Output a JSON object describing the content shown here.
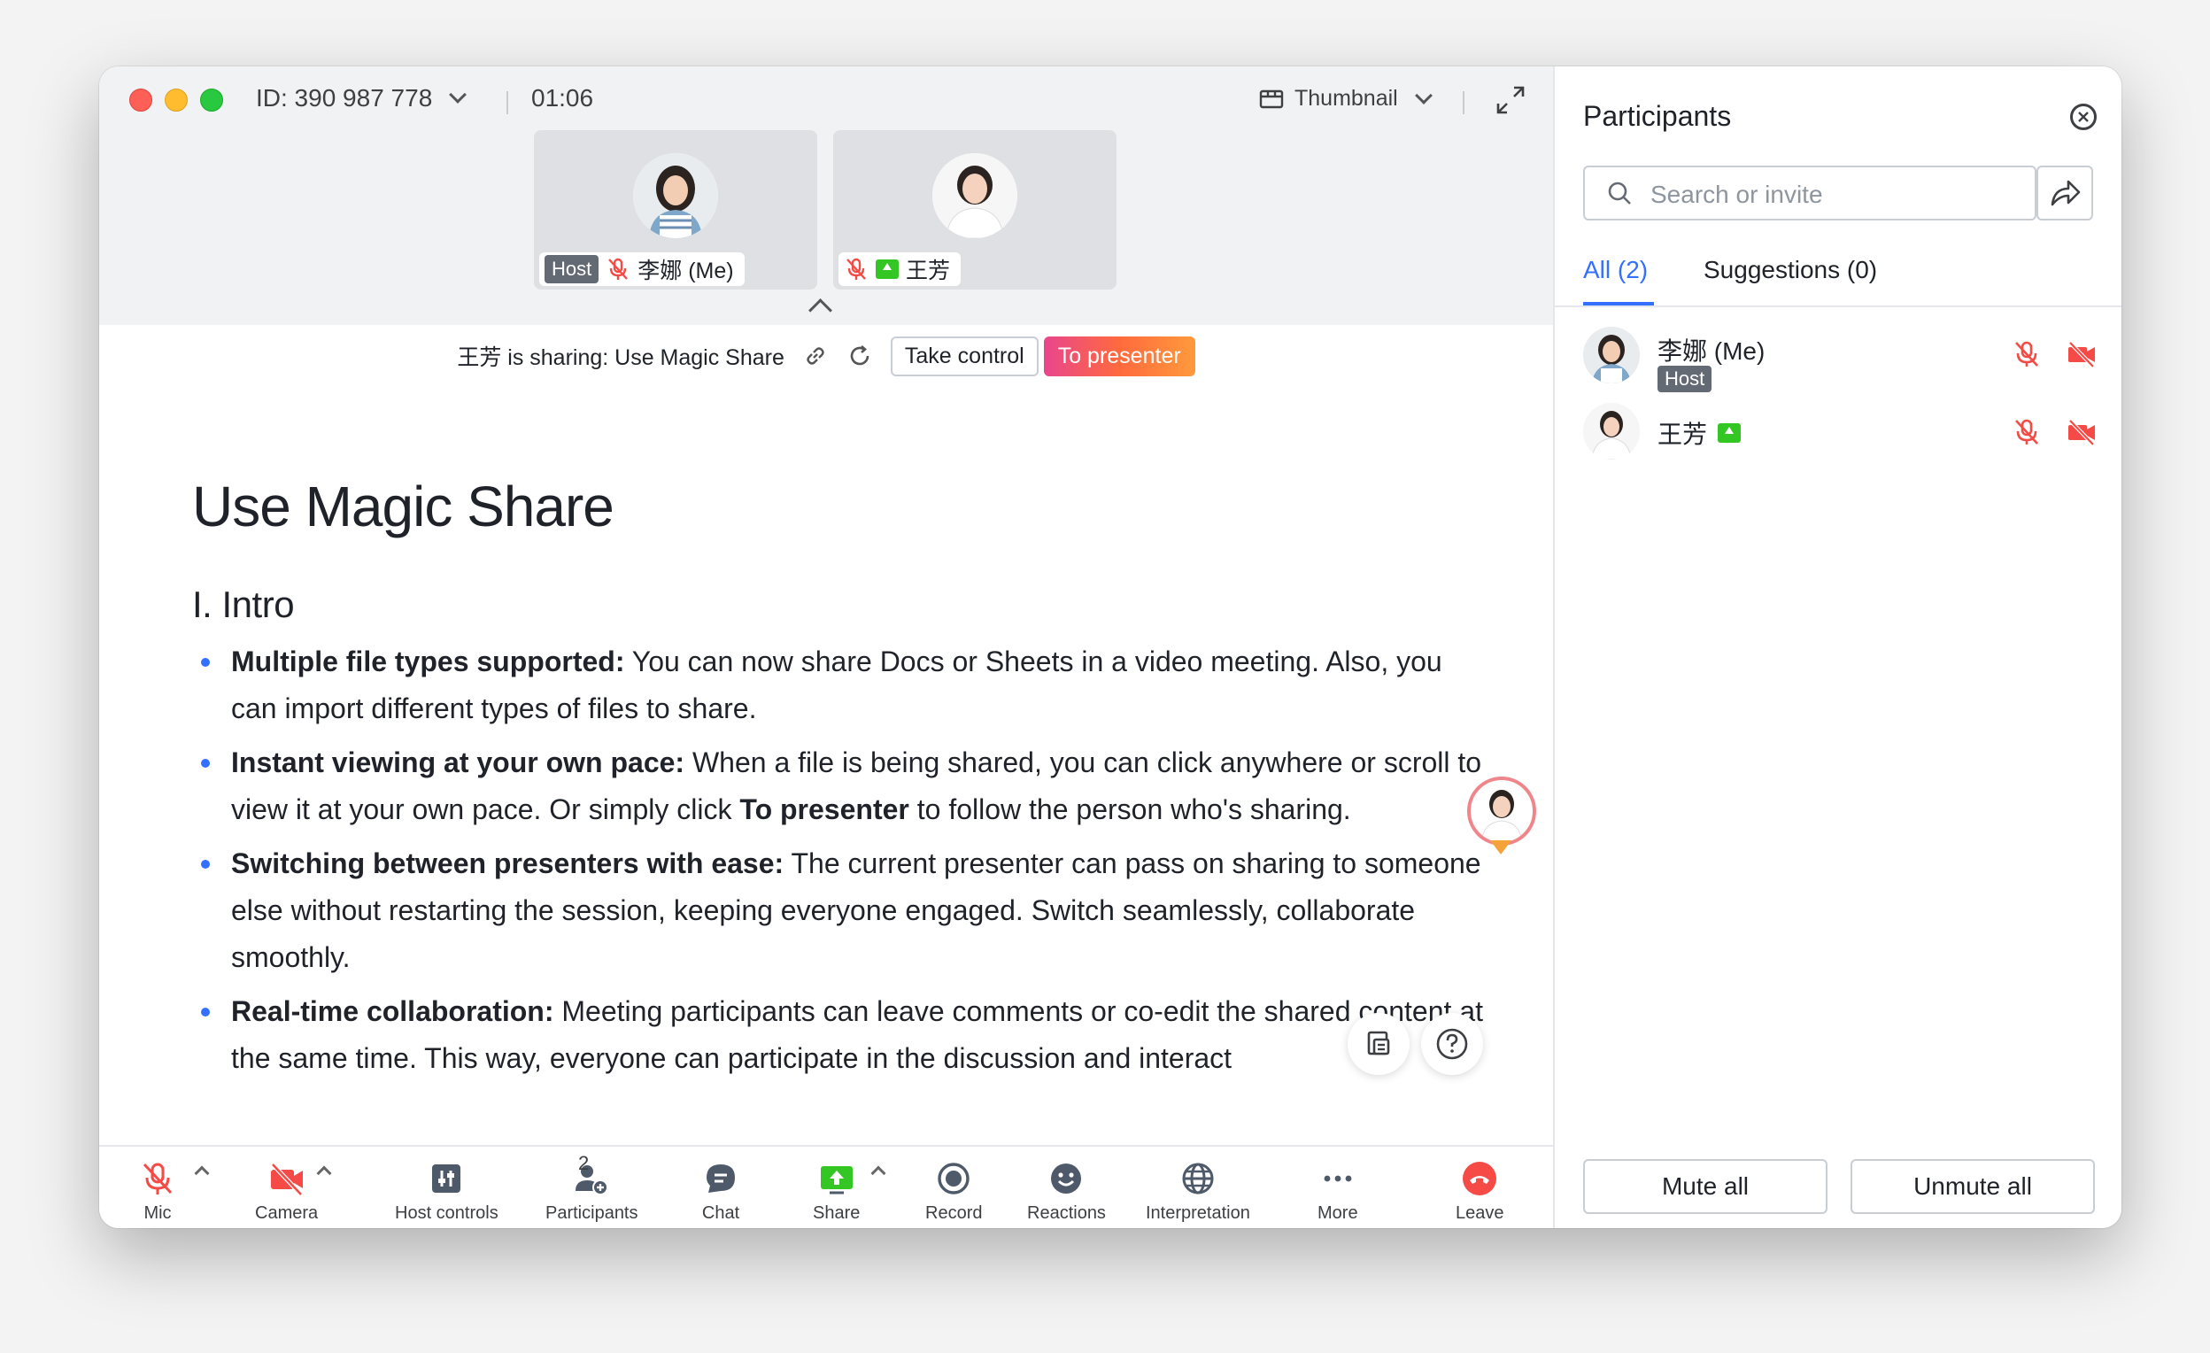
{
  "header": {
    "meeting_id": "ID: 390 987 778",
    "timer": "01:06",
    "view_mode": "Thumbnail"
  },
  "thumbnails": [
    {
      "host_badge": "Host",
      "name": "李娜 (Me)"
    },
    {
      "name": "王芳"
    }
  ],
  "sharing": {
    "status": "王芳 is sharing: Use Magic Share",
    "take_control": "Take control",
    "to_presenter": "To presenter"
  },
  "doc": {
    "title": "Use Magic Share",
    "section": "I. Intro",
    "items": [
      {
        "bold": "Multiple file types supported:",
        "text": " You can now share Docs or Sheets in a video meeting. Also, you can import different types of files to share."
      },
      {
        "bold": "Instant viewing at your own pace:",
        "text": " When a file is being shared, you can click anywhere or scroll to view it at your own pace. Or simply click ",
        "bold2": "To presenter",
        "text2": " to follow the person who's sharing."
      },
      {
        "bold": "Switching between presenters with ease:",
        "text": " The current presenter can pass on sharing to someone else without restarting the session, keeping everyone engaged. Switch seamlessly, collaborate smoothly."
      },
      {
        "bold": "Real-time collaboration:",
        "text": " Meeting participants can leave comments or co-edit the shared content at the same time. This way, everyone can participate in the discussion and interact"
      }
    ]
  },
  "toolbar": {
    "mic": "Mic",
    "camera": "Camera",
    "host_controls": "Host controls",
    "participants": "Participants",
    "participants_count": "2",
    "chat": "Chat",
    "share": "Share",
    "record": "Record",
    "reactions": "Reactions",
    "interpretation": "Interpretation",
    "more": "More",
    "leave": "Leave"
  },
  "panel": {
    "title": "Participants",
    "search_placeholder": "Search or invite",
    "tabs": {
      "all": "All (2)",
      "suggestions": "Suggestions (0)"
    },
    "participants": [
      {
        "name": "李娜 (Me)",
        "role": "Host"
      },
      {
        "name": "王芳"
      }
    ],
    "mute_all": "Mute all",
    "unmute_all": "Unmute all"
  },
  "colors": {
    "accent": "#3370ff",
    "muted_red": "#f54a45",
    "share_green": "#34c724",
    "leave_red": "#f54a45"
  }
}
